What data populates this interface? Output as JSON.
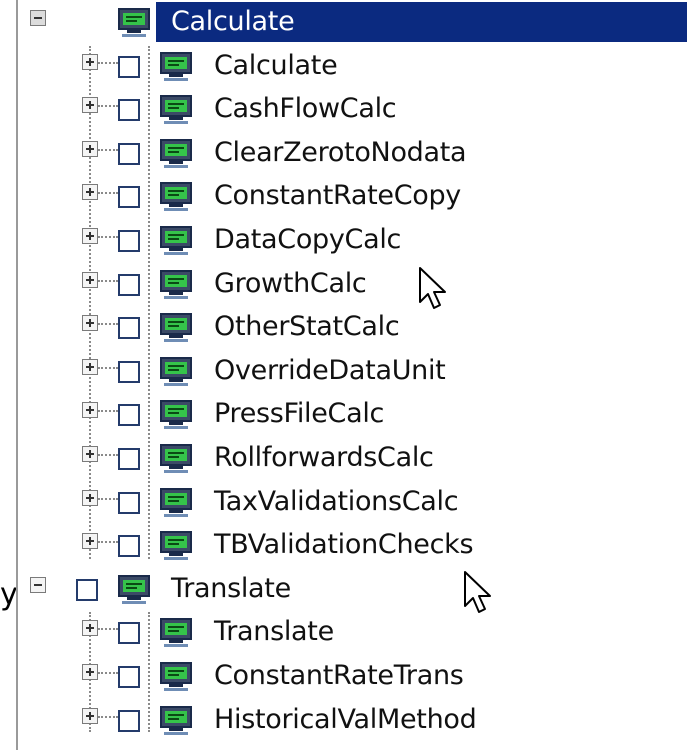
{
  "tree": {
    "nodes": [
      {
        "label": "Calculate",
        "level": 0,
        "expanded": true,
        "selected": true
      },
      {
        "label": "Calculate",
        "level": 1,
        "expanded": false
      },
      {
        "label": "CashFlowCalc",
        "level": 1,
        "expanded": false
      },
      {
        "label": "ClearZerotoNodata",
        "level": 1,
        "expanded": false
      },
      {
        "label": "ConstantRateCopy",
        "level": 1,
        "expanded": false
      },
      {
        "label": "DataCopyCalc",
        "level": 1,
        "expanded": false
      },
      {
        "label": "GrowthCalc",
        "level": 1,
        "expanded": false
      },
      {
        "label": "OtherStatCalc",
        "level": 1,
        "expanded": false
      },
      {
        "label": "OverrideDataUnit",
        "level": 1,
        "expanded": false
      },
      {
        "label": "PressFileCalc",
        "level": 1,
        "expanded": false
      },
      {
        "label": "RollforwardsCalc",
        "level": 1,
        "expanded": false
      },
      {
        "label": "TaxValidationsCalc",
        "level": 1,
        "expanded": false
      },
      {
        "label": "TBValidationChecks",
        "level": 1,
        "expanded": false
      },
      {
        "label": "Translate",
        "level": 0,
        "expanded": true
      },
      {
        "label": "Translate",
        "level": 1,
        "expanded": false
      },
      {
        "label": "ConstantRateTrans",
        "level": 1,
        "expanded": false
      },
      {
        "label": "HistoricalValMethod",
        "level": 1,
        "expanded": false
      }
    ]
  },
  "left_edge_text": "y",
  "icons": {
    "expander_expanded": "minus-box-icon",
    "expander_collapsed": "plus-box-icon",
    "node": "monitor-icon",
    "cursor": "mouse-pointer-icon"
  },
  "colors": {
    "selection": "#0b2a80",
    "selection_text": "#ffffff",
    "text": "#111111",
    "checkbox_border": "#243b6b",
    "monitor_screen": "#35c44a"
  }
}
